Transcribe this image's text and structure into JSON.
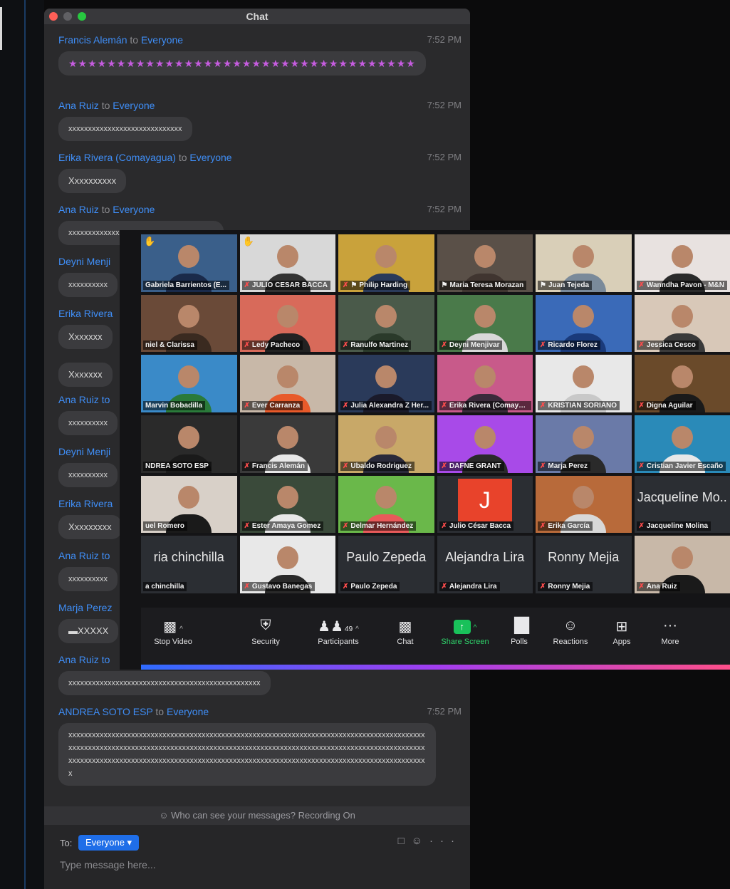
{
  "chat_window": {
    "title": "Chat",
    "to_word": "to",
    "messages": [
      {
        "sender": "Francis Alemán",
        "recipient": "Everyone",
        "time": "7:52 PM",
        "text": "★★★★★★★★★★★★★★★★★★★★★★★★★★★★★★★★★★★★",
        "kind": "stars"
      },
      {
        "sender": "Ana Ruiz",
        "recipient": "Everyone",
        "time": "7:52 PM",
        "text": "xxxxxxxxxxxxxxxxxxxxxxxxxxxxx"
      },
      {
        "sender": "Erika Rivera (Comayagua)",
        "recipient": "Everyone",
        "time": "7:52 PM",
        "text": "Xxxxxxxxxx",
        "large": true
      },
      {
        "sender": "Ana Ruiz",
        "recipient": "Everyone",
        "time": "7:52 PM",
        "text": "xxxxxxxxxxxxxxxxxxxxxxxxxxxxxxxxxxxxx"
      },
      {
        "sender": "Deyni Menji",
        "text": "xxxxxxxxxx"
      },
      {
        "sender": "Erika Rivera",
        "text": "Xxxxxxx",
        "large": true
      },
      {
        "sender": "",
        "text": "Xxxxxxx",
        "large": true
      },
      {
        "sender": "Ana Ruiz to",
        "text": "xxxxxxxxxx"
      },
      {
        "sender": "Deyni Menji",
        "text": "xxxxxxxxxx"
      },
      {
        "sender": "Erika Rivera",
        "text": "Xxxxxxxxx",
        "large": true
      },
      {
        "sender": "Ana Ruiz to",
        "text": "xxxxxxxxxx"
      },
      {
        "sender": "Marja Perez",
        "text": "▬XXXXX",
        "large": true
      },
      {
        "sender": "Ana Ruiz to",
        "text": "xxxxxxxxxxxxxxxxxxxxxxxxxxxxxxxxxxxxxxxxxxxxxxxxx"
      },
      {
        "sender": "ANDREA SOTO ESP",
        "recipient": "Everyone",
        "time": "7:52 PM",
        "text": "xxxxxxxxxxxxxxxxxxxxxxxxxxxxxxxxxxxxxxxxxxxxxxxxxxxxxxxxxxxxxxxxxxxxxxxxxxxxxxxxxxxxxxxxxxxxxxxxxxxxxxxxxxxxxxxxxxxxxxxxxxxxxxxxxxxxxxxxxxxxxxxxxxxxxxxxxxxxxxxxxxxxxxxxxxxxxxxxxxxxxxxxxxxxxxxxxxxxxxxxxxxxxxxxxxxxxxxxxxxxxxxxxxxxxxxxxxxxxxxxxxxxxxxxxxxxxxxxxxxxxxxxxxxxxxxxxx"
      }
    ],
    "notice": "Who can see your messages? Recording On",
    "to_label": "To:",
    "to_value": "Everyone ▾",
    "input_placeholder": "Type message here..."
  },
  "gallery": {
    "tiles": [
      {
        "name": "Gabriela Barrientos (E...",
        "muted": false,
        "hand": true,
        "bg": "#3a5f8a",
        "shirt": "#1a2a4a"
      },
      {
        "name": "JULIO CESAR BACCA",
        "muted": true,
        "hand": true,
        "bg": "#d8d8d8",
        "shirt": "#333"
      },
      {
        "name": "Philip Harding",
        "muted": true,
        "bg": "#c9a23b",
        "shirt": "#2a3a5a",
        "pin": true
      },
      {
        "name": "Maria Teresa Morazan",
        "muted": false,
        "bg": "#5a5048",
        "shirt": "#403530",
        "pin": true
      },
      {
        "name": "Juan Tejeda",
        "muted": false,
        "active": true,
        "bg": "#d9cfb8",
        "shirt": "#7a8a9a",
        "pin": true
      },
      {
        "name": "Wanndha Pavon - M&N",
        "muted": true,
        "bg": "#e8e2e0",
        "shirt": "#2a2a2a"
      },
      {
        "name": "niel & Clarissa",
        "muted": false,
        "bg": "#6a4a38",
        "shirt": "#3a2a20"
      },
      {
        "name": "Ledy Pacheco",
        "muted": true,
        "bg": "#d86a5a",
        "shirt": "#222"
      },
      {
        "name": "Ranulfo Martinez",
        "muted": true,
        "bg": "#4a5a4a",
        "shirt": "#2a3a2a"
      },
      {
        "name": "Deyni Menjivar",
        "muted": true,
        "bg": "#4a7a4a",
        "shirt": "#d8d8d8"
      },
      {
        "name": "Ricardo Florez",
        "muted": true,
        "bg": "#3a6ab8",
        "shirt": "#1a3a7a"
      },
      {
        "name": "Jessica Cesco",
        "muted": true,
        "bg": "#d8c8b8",
        "shirt": "#3a3a3a"
      },
      {
        "name": "Marvin Bobadilla",
        "muted": false,
        "bg": "#3a8ac8",
        "shirt": "#2a7a3a"
      },
      {
        "name": "Ever Carranza",
        "muted": true,
        "bg": "#c8b8a8",
        "shirt": "#e85a2a"
      },
      {
        "name": "Julia Alexandra Z Her...",
        "muted": true,
        "bg": "#2a3a5a",
        "shirt": "#1a1a2a"
      },
      {
        "name": "Erika Rivera (Comays...",
        "muted": true,
        "bg": "#c85a8a",
        "shirt": "#3a2a3a"
      },
      {
        "name": "KRISTIAN SORIANO",
        "muted": true,
        "bg": "#e8e8e8",
        "shirt": "#c8c8c8"
      },
      {
        "name": "Digna Aguilar",
        "muted": true,
        "bg": "#6a4a2a",
        "shirt": "#1a1a1a"
      },
      {
        "name": "NDREA SOTO ESP",
        "muted": false,
        "bg": "#2a2a2a",
        "shirt": "#1a1a1a"
      },
      {
        "name": "Francis Alemán",
        "muted": true,
        "bg": "#3a3a3a",
        "shirt": "#e8e8e8"
      },
      {
        "name": "Ubaldo Rodriguez",
        "muted": true,
        "bg": "#c8a868",
        "shirt": "#2a2a3a"
      },
      {
        "name": "DAFNE GRANT",
        "muted": true,
        "bg": "#a84ae8",
        "shirt": "#2a2a2a"
      },
      {
        "name": "Marja Perez",
        "muted": true,
        "bg": "#6a7aa8",
        "shirt": "#2a2a2a"
      },
      {
        "name": "Cristian Javier Escaño",
        "muted": true,
        "bg": "#2a8ab8",
        "shirt": "#e8e8e8"
      },
      {
        "name": "uel Romero",
        "muted": false,
        "bg": "#d8d0c8",
        "shirt": "#1a1a1a"
      },
      {
        "name": "Ester Amaya Gomez",
        "muted": true,
        "bg": "#3a4a3a",
        "shirt": "#e8e8e8"
      },
      {
        "name": "Delmar Hernández",
        "muted": true,
        "bg": "#6ab84a",
        "shirt": "#e85a5a"
      },
      {
        "name": "Julio César Bacca",
        "muted": true,
        "initial": "J",
        "bg": "#2b2e33"
      },
      {
        "name": "Erika García",
        "muted": true,
        "bg": "#b86a3a",
        "shirt": "#d8d8d8"
      },
      {
        "name": "Jacqueline Molina",
        "muted": true,
        "big": "Jacqueline Mo..",
        "bg": "#2b2e33"
      },
      {
        "name": "a chinchilla",
        "muted": false,
        "big": "ria chinchilla",
        "bg": "#2b2e33"
      },
      {
        "name": "Gustavo Banegas",
        "muted": true,
        "bg": "#e8e8e8",
        "shirt": "#2a2a2a"
      },
      {
        "name": "Paulo Zepeda",
        "muted": true,
        "big": "Paulo Zepeda",
        "bg": "#2b2e33"
      },
      {
        "name": "Alejandra Lira",
        "muted": true,
        "big": "Alejandra Lira",
        "bg": "#2b2e33"
      },
      {
        "name": "Ronny Mejia",
        "muted": true,
        "big": "Ronny Mejia",
        "bg": "#2b2e33"
      },
      {
        "name": "Ana Ruiz",
        "muted": true,
        "bg": "#c8b8a8",
        "shirt": "#1a1a1a"
      }
    ],
    "toolbar": {
      "stop_video": "Stop Video",
      "security": "Security",
      "participants": "Participants",
      "participant_count": "49",
      "chat": "Chat",
      "share_screen": "Share Screen",
      "polls": "Polls",
      "reactions": "Reactions",
      "apps": "Apps",
      "more": "More"
    }
  }
}
